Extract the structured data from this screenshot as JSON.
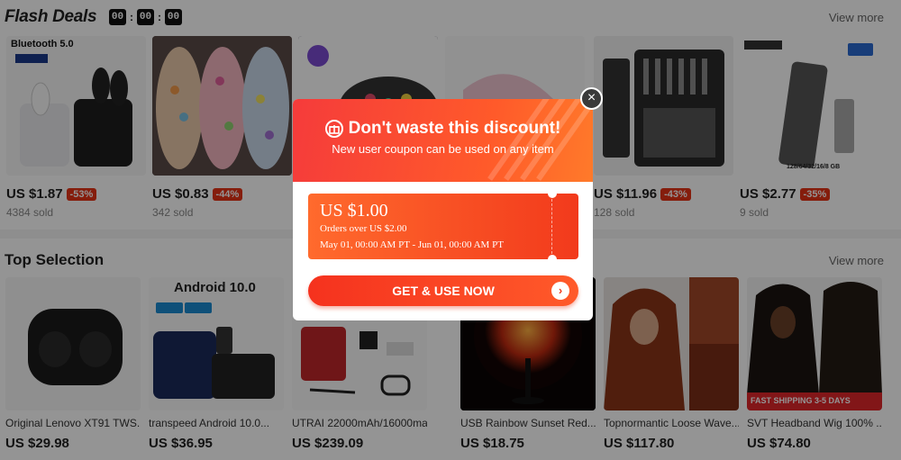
{
  "flash_deals": {
    "title": "Flash Deals",
    "countdown": [
      "00",
      "00",
      "00"
    ],
    "view_more": "View more",
    "items": [
      {
        "price": "US $1.87",
        "discount": "-53%",
        "sold": "4384 sold",
        "image_label": "Bluetooth 5.0"
      },
      {
        "price": "US $0.83",
        "discount": "-44%",
        "sold": "342 sold"
      },
      {
        "price": "",
        "discount": "",
        "sold": ""
      },
      {
        "price": "",
        "discount": "",
        "sold": ""
      },
      {
        "price": "US $11.96",
        "discount": "-43%",
        "sold": "128 sold"
      },
      {
        "price": "US $2.77",
        "discount": "-35%",
        "sold": "9 sold",
        "image_label": "128/64/32/16/8 GB"
      }
    ]
  },
  "top_selection": {
    "title": "Top Selection",
    "view_more": "View more",
    "items": [
      {
        "name": "Original Lenovo XT91 TWS...",
        "price": "US $29.98"
      },
      {
        "name": "transpeed Android 10.0...",
        "price": "US $36.95",
        "image_label": "Android 10.0"
      },
      {
        "name": "UTRAI 22000mAh/16000ma...",
        "price": "US $239.09"
      },
      {
        "name": "USB Rainbow Sunset Red...",
        "price": "US $18.75"
      },
      {
        "name": "Topnormantic Loose Wave...",
        "price": "US $117.80"
      },
      {
        "name": "SVT Headband Wig 100% ...",
        "price": "US $74.80",
        "image_label": "FAST SHIPPING 3-5 DAYS"
      }
    ]
  },
  "modal": {
    "title": "Don't waste this discount!",
    "subtitle": "New user coupon can be used on any item",
    "coupon": {
      "amount": "US $1.00",
      "condition": "Orders over US $2.00",
      "dates": "May 01, 00:00 AM PT - Jun 01, 00:00 AM PT"
    },
    "button_label": "GET & USE NOW",
    "close_symbol": "×"
  },
  "colors": {
    "accent_red": "#f23a1c",
    "discount_red": "#e63216",
    "overlay": "rgba(0,0,0,0.42)"
  },
  "icons": [
    "gift-icon",
    "arrow-right-icon",
    "close-icon"
  ]
}
